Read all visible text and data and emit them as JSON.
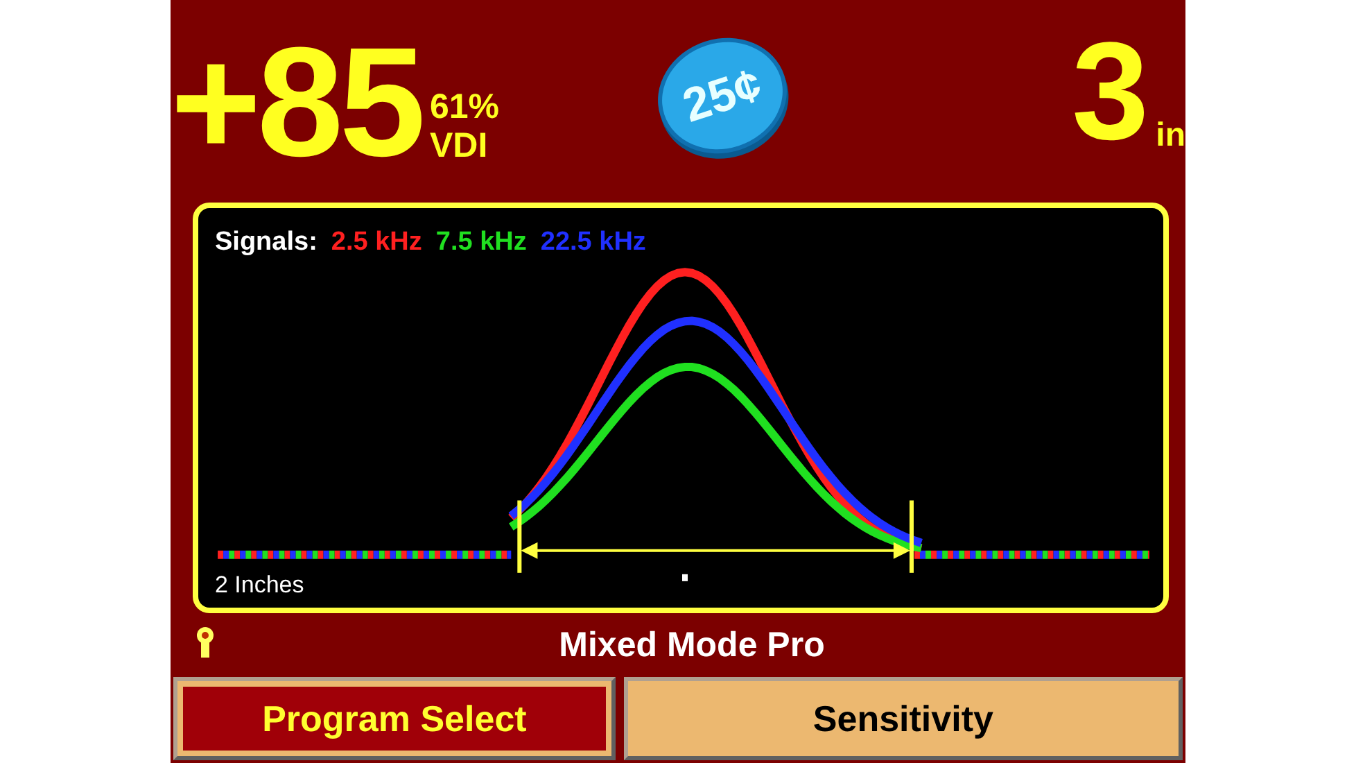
{
  "readout": {
    "value": "+85",
    "percent": "61%",
    "unit_label": "VDI"
  },
  "coin": {
    "label": "25¢"
  },
  "depth": {
    "value": "3",
    "unit": "in"
  },
  "graph": {
    "legend_title": "Signals:",
    "signals": [
      {
        "label": "2.5 kHz",
        "color": "#ff2020"
      },
      {
        "label": "7.5 kHz",
        "color": "#20e020"
      },
      {
        "label": "22.5 kHz",
        "color": "#2030ff"
      }
    ],
    "scale_label": "2 Inches"
  },
  "mode_title": "Mixed Mode Pro",
  "buttons": [
    {
      "label": "Program Select",
      "selected": true
    },
    {
      "label": "Sensitivity",
      "selected": false
    }
  ]
}
